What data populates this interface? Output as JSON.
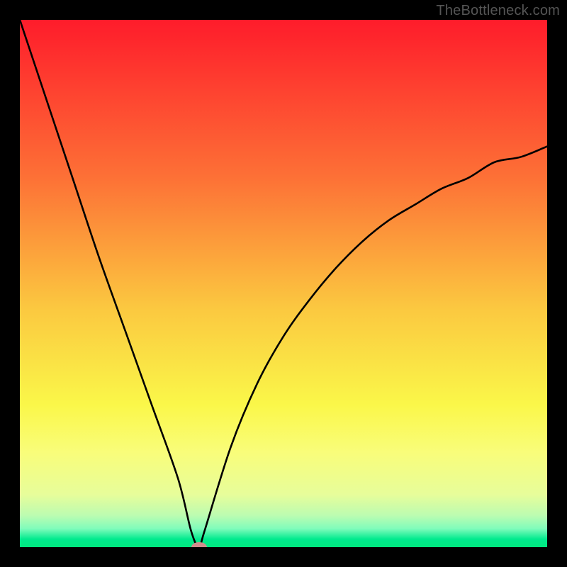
{
  "attribution": "TheBottleneck.com",
  "chart_data": {
    "type": "line",
    "title": "",
    "xlabel": "",
    "ylabel": "",
    "xlim": [
      0,
      1
    ],
    "ylim": [
      0,
      100
    ],
    "x": [
      0.0,
      0.05,
      0.1,
      0.15,
      0.2,
      0.25,
      0.3,
      0.325,
      0.34,
      0.35,
      0.4,
      0.45,
      0.5,
      0.55,
      0.6,
      0.65,
      0.7,
      0.75,
      0.8,
      0.85,
      0.9,
      0.95,
      1.0
    ],
    "values": [
      100,
      85,
      70,
      55,
      41,
      27,
      13,
      3,
      0,
      3,
      19,
      31,
      40,
      47,
      53,
      58,
      62,
      65,
      68,
      70,
      73,
      74,
      76
    ],
    "marker": {
      "x": 0.34,
      "y": 0,
      "shape": "ellipse",
      "color": "#d08d8c"
    },
    "background_gradient_stops": [
      {
        "offset": 0.0,
        "color": "#fe1c2b"
      },
      {
        "offset": 0.3,
        "color": "#fd7136"
      },
      {
        "offset": 0.55,
        "color": "#fbc940"
      },
      {
        "offset": 0.73,
        "color": "#faf749"
      },
      {
        "offset": 0.82,
        "color": "#f9fd7a"
      },
      {
        "offset": 0.9,
        "color": "#e7fd9a"
      },
      {
        "offset": 0.94,
        "color": "#bcfcb1"
      },
      {
        "offset": 0.965,
        "color": "#7ffcbb"
      },
      {
        "offset": 0.985,
        "color": "#00ea8e"
      },
      {
        "offset": 1.0,
        "color": "#00e97f"
      }
    ]
  }
}
